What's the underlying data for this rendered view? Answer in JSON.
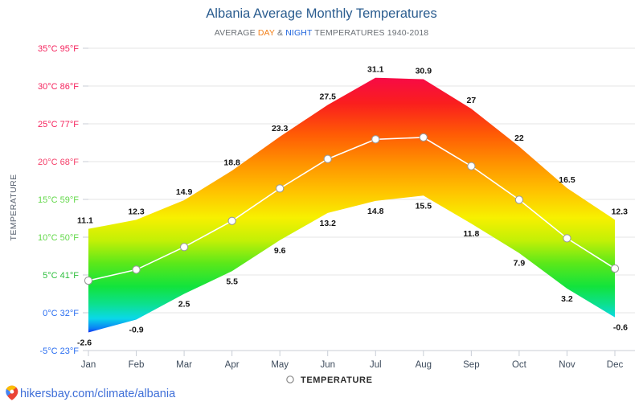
{
  "header": {
    "title": "Albania Average Monthly Temperatures",
    "subtitle_pre": "AVERAGE ",
    "subtitle_day": "DAY",
    "subtitle_mid": " & ",
    "subtitle_night": "NIGHT",
    "subtitle_post": " TEMPERATURES 1940-2018",
    "title_color": "#2a5c8f",
    "day_color": "#f2801a",
    "night_color": "#2266dd"
  },
  "legend": {
    "label": "TEMPERATURE",
    "marker": "circle-outline-icon"
  },
  "footer": {
    "link_text": "hikersbay.com/climate/albania",
    "pin_icon": "map-pin-icon",
    "link_color": "#3f6fd8"
  },
  "chart_data": {
    "type": "area",
    "title": "Albania Average Monthly Temperatures",
    "subtitle": "AVERAGE DAY & NIGHT TEMPERATURES 1940-2018",
    "xlabel": "",
    "ylabel": "TEMPERATURE",
    "categories": [
      "Jan",
      "Feb",
      "Mar",
      "Apr",
      "May",
      "Jun",
      "Jul",
      "Aug",
      "Sep",
      "Oct",
      "Nov",
      "Dec"
    ],
    "ylim": [
      -5,
      35
    ],
    "grid": true,
    "legend_position": "bottom",
    "y_ticks": [
      {
        "value": 35,
        "label": "35°C 95°F",
        "color": "#f5245e"
      },
      {
        "value": 30,
        "label": "30°C 86°F",
        "color": "#f5245e"
      },
      {
        "value": 25,
        "label": "25°C 77°F",
        "color": "#f5245e"
      },
      {
        "value": 20,
        "label": "20°C 68°F",
        "color": "#f5406a"
      },
      {
        "value": 15,
        "label": "15°C 59°F",
        "color": "#63d84a"
      },
      {
        "value": 10,
        "label": "10°C 50°F",
        "color": "#63d84a"
      },
      {
        "value": 5,
        "label": "5°C 41°F",
        "color": "#2fbf3f"
      },
      {
        "value": 0,
        "label": "0°C 32°F",
        "color": "#2a6ef0"
      },
      {
        "value": -5,
        "label": "-5°C 23°F",
        "color": "#2a6ef0"
      }
    ],
    "series": [
      {
        "name": "DAY",
        "values": [
          11.1,
          12.3,
          14.9,
          18.8,
          23.3,
          27.5,
          31.1,
          30.9,
          27,
          22,
          16.5,
          12.3
        ],
        "labels": [
          "11.1",
          "12.3",
          "14.9",
          "18.8",
          "23.3",
          "27.5",
          "31.1",
          "30.9",
          "27",
          "22",
          "16.5",
          "12.3"
        ]
      },
      {
        "name": "NIGHT",
        "values": [
          -2.6,
          -0.9,
          2.5,
          5.5,
          9.6,
          13.2,
          14.8,
          15.5,
          11.8,
          7.9,
          3.2,
          -0.6
        ],
        "labels": [
          "-2.6",
          "-0.9",
          "2.5",
          "5.5",
          "9.6",
          "13.2",
          "14.8",
          "15.5",
          "11.8",
          "7.9",
          "3.2",
          "-0.6"
        ]
      },
      {
        "name": "TEMPERATURE",
        "values": [
          4.25,
          5.7,
          8.7,
          12.15,
          16.45,
          20.35,
          22.95,
          23.2,
          19.4,
          14.95,
          9.85,
          5.85
        ]
      }
    ]
  }
}
